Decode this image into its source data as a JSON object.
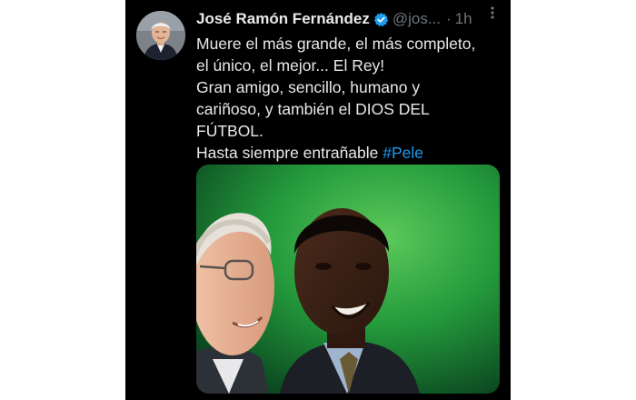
{
  "tweet": {
    "author_name": "José Ramón Fernández",
    "handle": "@jos...",
    "separator": "·",
    "time": "1h",
    "text_lines": [
      "Muere el más grande, el más completo,",
      "el único, el mejor... El Rey!",
      "Gran amigo, sencillo, humano y",
      "cariñoso, y también el DIOS DEL",
      "FÚTBOL."
    ],
    "last_line_prefix": "Hasta siempre entrañable ",
    "hashtag": "#Pele"
  },
  "icons": {
    "verified": "verified-badge-icon",
    "more": "more-options-icon"
  },
  "colors": {
    "background": "#000000",
    "text": "#e7e9ea",
    "secondary": "#71767b",
    "link": "#1d9bf0",
    "verified": "#1d9bf0",
    "photo_backdrop": "#1f8a3c"
  }
}
